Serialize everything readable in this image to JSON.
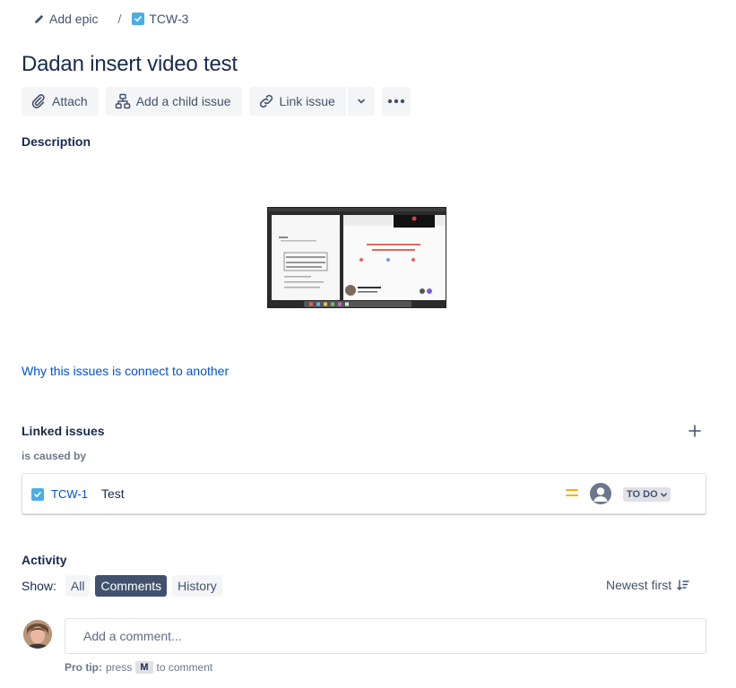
{
  "breadcrumb": {
    "add_epic": "Add epic",
    "separator": "/",
    "issue_key": "TCW-3"
  },
  "issue": {
    "title": "Dadan insert video test"
  },
  "toolbar": {
    "attach": "Attach",
    "add_child": "Add a child issue",
    "link_issue": "Link issue"
  },
  "description": {
    "label": "Description",
    "link_text": "Why this issues is connect to another"
  },
  "linked_issues": {
    "title": "Linked issues",
    "link_type": "is caused by",
    "items": [
      {
        "key": "TCW-1",
        "summary": "Test",
        "priority": "medium",
        "status": "TO DO"
      }
    ]
  },
  "activity": {
    "title": "Activity",
    "show_label": "Show:",
    "filters": [
      "All",
      "Comments",
      "History"
    ],
    "active_filter": "Comments",
    "sort_label": "Newest first"
  },
  "comment": {
    "placeholder": "Add a comment...",
    "pro_tip_label": "Pro tip:",
    "pro_tip_press": "press",
    "pro_tip_key": "M",
    "pro_tip_suffix": "to comment"
  },
  "colors": {
    "link": "#0052cc",
    "task_icon": "#4bade8",
    "priority_medium": "#ffab00",
    "active_filter_bg": "#42526e"
  }
}
